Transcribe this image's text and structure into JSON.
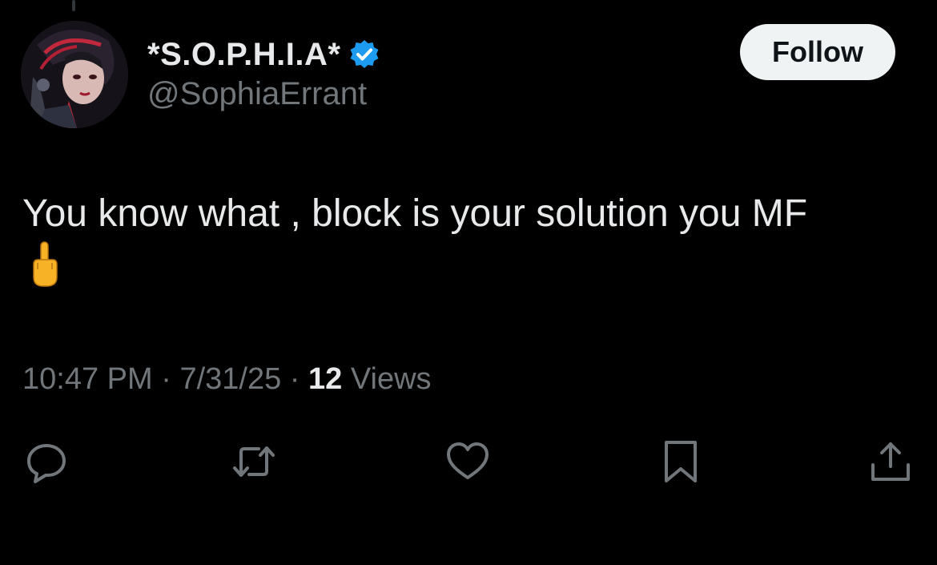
{
  "author": {
    "display_name": "*S.O.P.H.I.A*",
    "handle": "@SophiaErrant",
    "verified": true,
    "verified_color": "#1d9bf0"
  },
  "follow_button": {
    "label": "Follow"
  },
  "tweet": {
    "text": "You know what , block is your solution you MF",
    "emoji": "middle-finger-emoji"
  },
  "meta": {
    "time": "10:47 PM",
    "separator": "·",
    "date": "7/31/25",
    "views_count": "12",
    "views_label": "Views"
  },
  "actions": [
    {
      "name": "reply-icon"
    },
    {
      "name": "retweet-icon"
    },
    {
      "name": "like-icon"
    },
    {
      "name": "bookmark-icon"
    },
    {
      "name": "share-icon"
    }
  ],
  "colors": {
    "background": "#000000",
    "text_primary": "#e7e9ea",
    "text_secondary": "#71767b",
    "follow_bg": "#eff3f4"
  }
}
